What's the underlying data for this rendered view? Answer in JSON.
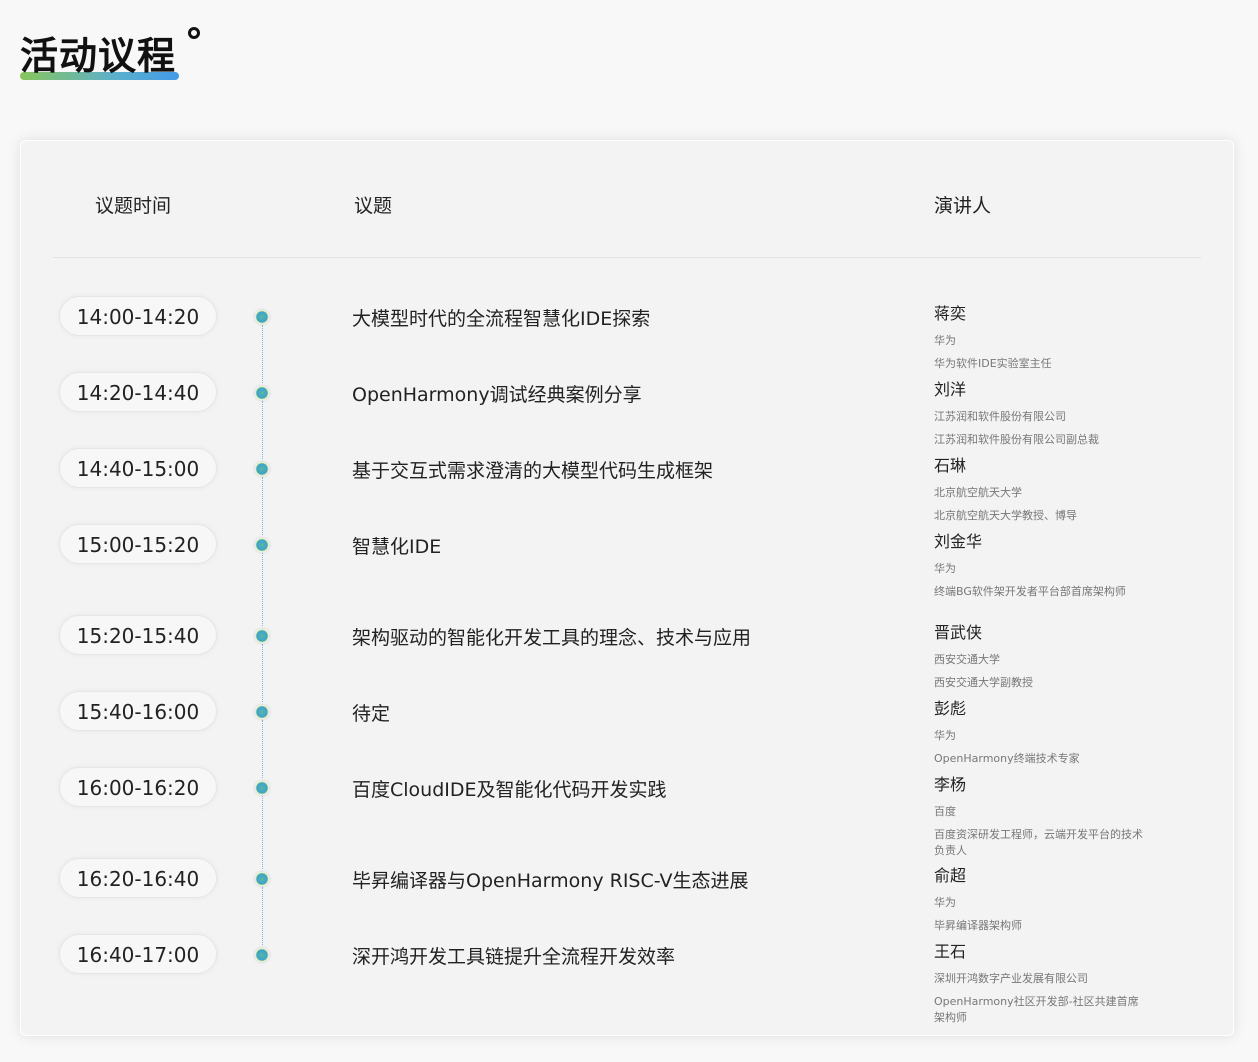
{
  "page": {
    "title": "活动议程"
  },
  "table": {
    "headers": {
      "time": "议题时间",
      "topic": "议题",
      "speaker": "演讲人"
    },
    "rows": [
      {
        "time": "14:00-14:20",
        "topic": "大模型时代的全流程智慧化IDE探索",
        "name": "蒋奕",
        "org": "华为",
        "title": "华为软件IDE实验室主任"
      },
      {
        "time": "14:20-14:40",
        "topic": "OpenHarmony调试经典案例分享",
        "name": "刘洋",
        "org": "江苏润和软件股份有限公司",
        "title": "江苏润和软件股份有限公司副总裁"
      },
      {
        "time": "14:40-15:00",
        "topic": "基于交互式需求澄清的大模型代码生成框架",
        "name": "石琳",
        "org": "北京航空航天大学",
        "title": "北京航空航天大学教授、博导"
      },
      {
        "time": "15:00-15:20",
        "topic": "智慧化IDE",
        "name": "刘金华",
        "org": "华为",
        "title": "终端BG软件架开发者平台部首席架构师"
      },
      {
        "time": "15:20-15:40",
        "topic": "架构驱动的智能化开发工具的理念、技术与应用",
        "name": "晋武侠",
        "org": "西安交通大学",
        "title": "西安交通大学副教授"
      },
      {
        "time": "15:40-16:00",
        "topic": "待定",
        "name": "彭彪",
        "org": "华为",
        "title": "OpenHarmony终端技术专家"
      },
      {
        "time": "16:00-16:20",
        "topic": "百度CloudIDE及智能化代码开发实践",
        "name": "李杨",
        "org": "百度",
        "title": "百度资深研发工程师，云端开发平台的技术负责人"
      },
      {
        "time": "16:20-16:40",
        "topic": "毕昇编译器与OpenHarmony RISC-V生态进展",
        "name": "俞超",
        "org": "华为",
        "title": "毕昇编译器架构师"
      },
      {
        "time": "16:40-17:00",
        "topic": "深开鸿开发工具链提升全流程开发效率",
        "name": "王石",
        "org": "深圳开鸿数字产业发展有限公司",
        "title": "OpenHarmony社区开发部-社区共建首席架构师"
      }
    ]
  }
}
